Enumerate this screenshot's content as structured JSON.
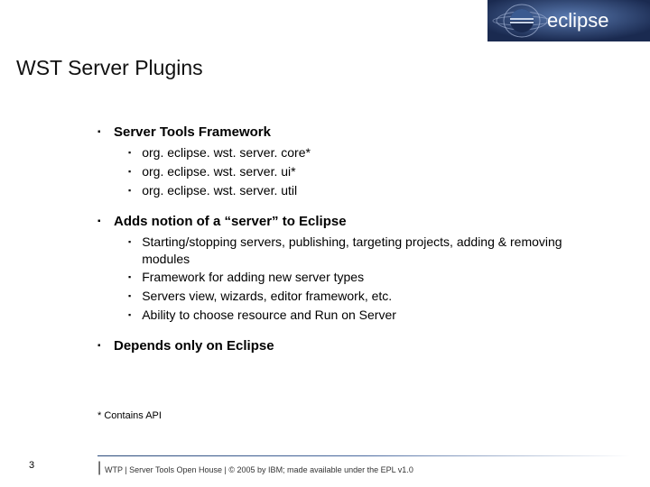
{
  "logo_text": "eclipse",
  "title": "WST Server Plugins",
  "bullets": [
    {
      "label": "Server Tools Framework",
      "children": [
        "org. eclipse. wst. server. core*",
        "org. eclipse. wst. server. ui*",
        "org. eclipse. wst. server. util"
      ]
    },
    {
      "label": "Adds notion of a “server” to Eclipse",
      "children": [
        "Starting/stopping servers, publishing, targeting projects, adding & removing modules",
        "Framework for adding new server types",
        "Servers view, wizards, editor framework, etc.",
        "Ability to choose resource and Run on Server"
      ]
    },
    {
      "label": "Depends only on Eclipse",
      "children": []
    }
  ],
  "footnote": "* Contains API",
  "page_number": "3",
  "footer": "WTP  |  Server Tools Open House  |  © 2005 by IBM; made available under the EPL v1.0"
}
